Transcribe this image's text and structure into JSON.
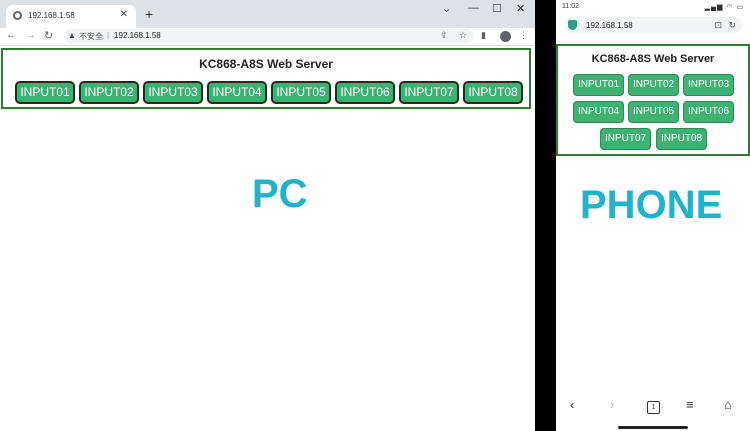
{
  "pc": {
    "tab_title": "192.168.1.58",
    "not_secure": "不安全",
    "url": "192.168.1.58",
    "page_title": "KC868-A8S Web Server",
    "buttons": [
      "INPUT01",
      "INPUT02",
      "INPUT03",
      "INPUT04",
      "INPUT05",
      "INPUT06",
      "INPUT07",
      "INPUT08"
    ],
    "label": "PC"
  },
  "phone": {
    "time": "11:02",
    "url": "192.168.1.58",
    "page_title": "KC868-A8S Web Server",
    "buttons": [
      "INPUT01",
      "INPUT02",
      "INPUT03",
      "INPUT04",
      "INPUT05",
      "INPUT06",
      "INPUT07",
      "INPUT08"
    ],
    "label": "PHONE",
    "tab_count": "1"
  },
  "colors": {
    "button_green": "#3cb371",
    "panel_border": "#2e7d32",
    "label_cyan": "#1fb4cc"
  }
}
